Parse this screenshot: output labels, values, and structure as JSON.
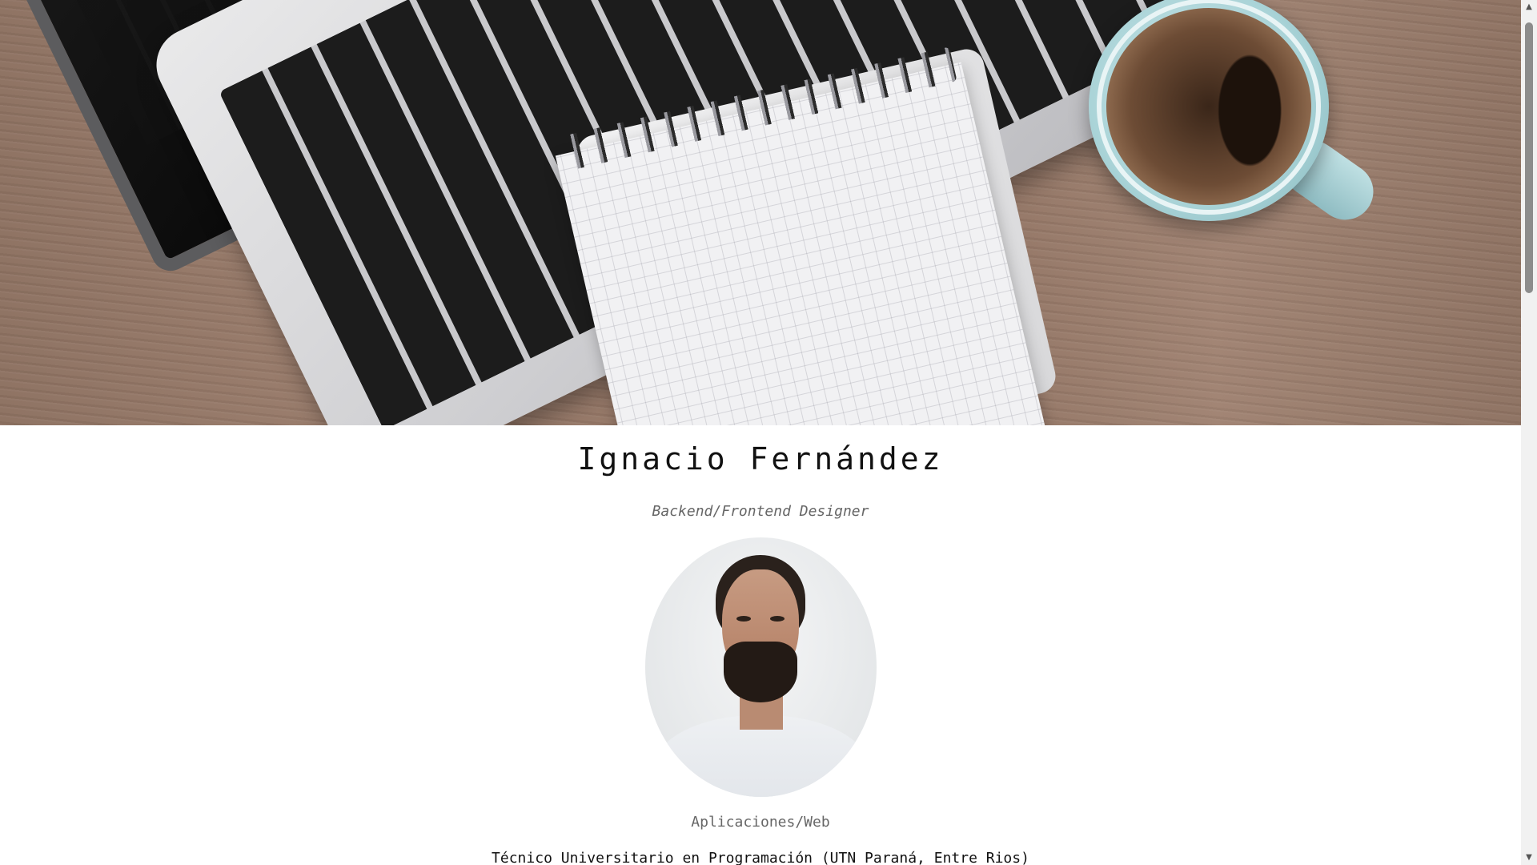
{
  "hero": {
    "image": "laptop-notebook-coffee-desk-photo"
  },
  "profile": {
    "name": "Ignacio Fernández",
    "role": "Backend/Frontend Designer",
    "avatar": "profile-photo",
    "category": "Aplicaciones/Web",
    "education": "Técnico Universitario en Programación (UTN Paraná, Entre Rios)"
  },
  "scrollbar": {
    "up_icon": "▲",
    "down_icon": "▼"
  }
}
